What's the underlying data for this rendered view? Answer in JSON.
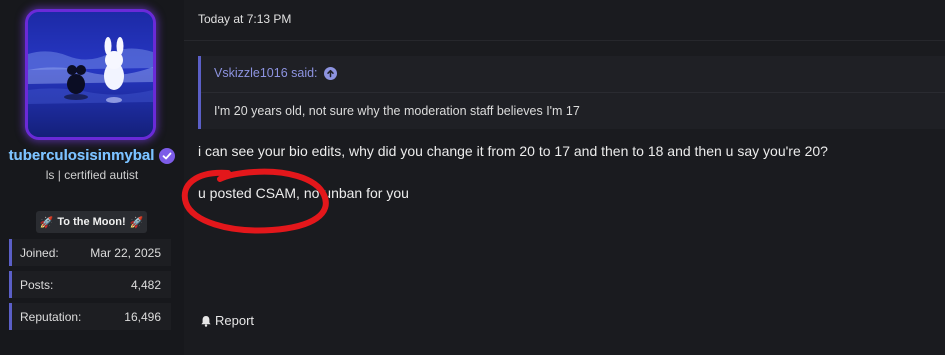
{
  "user": {
    "name": "tuberculosisinmybal",
    "title": "ls | certified autist",
    "banner_label": "To the Moon!",
    "stats": [
      {
        "label": "Joined:",
        "value": "Mar 22, 2025"
      },
      {
        "label": "Posts:",
        "value": "4,482"
      },
      {
        "label": "Reputation:",
        "value": "16,496"
      }
    ],
    "verified_icon": "verified-badge-icon"
  },
  "post": {
    "timestamp": "Today at 7:13 PM",
    "quote": {
      "author": "Vskizzle1016 said:",
      "text": "I'm 20 years old, not sure why the moderation staff believes I'm 17"
    },
    "messages": [
      "i can see your bio edits, why did you change it from 20 to 17 and then to 18 and then u say you're 20?",
      "u posted CSAM, no unban for you"
    ],
    "report_label": "Report"
  },
  "colors": {
    "accent": "#5b5fc7",
    "annotation": "#e3171b"
  }
}
